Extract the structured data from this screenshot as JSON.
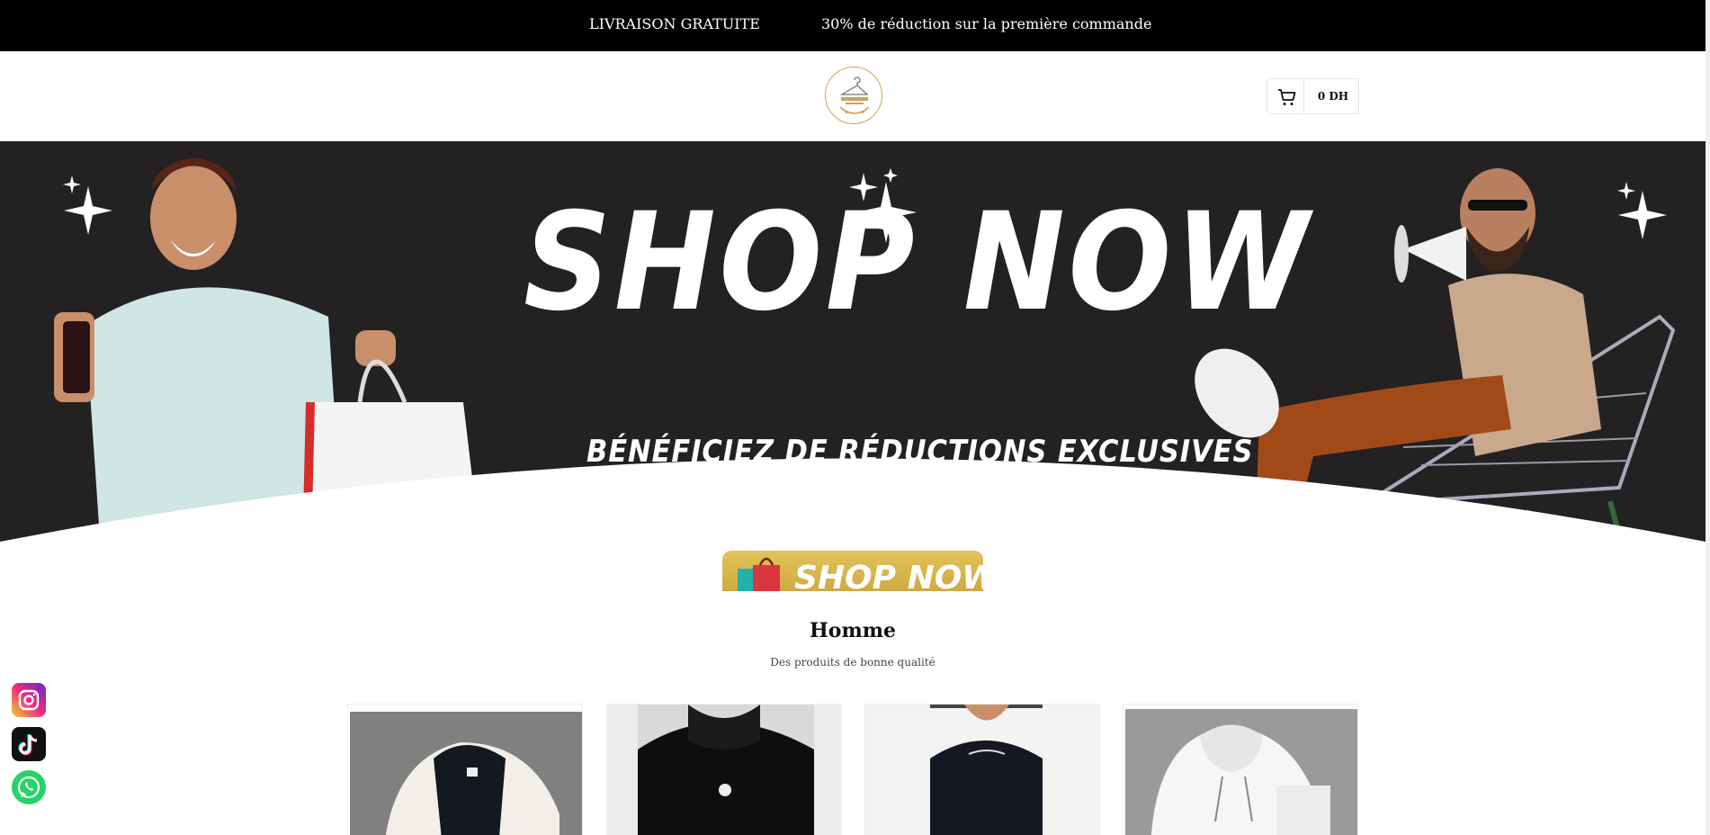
{
  "announcement_bar": {
    "items": [
      "LIVRAISON GRATUITE",
      "30% de réduction sur la première commande"
    ]
  },
  "header": {
    "logo_icon": "hanger-logo-icon",
    "cart": {
      "icon": "cart-icon",
      "total": "0 DH"
    }
  },
  "hero": {
    "title": "SHOP NOW",
    "subtitle": "BÉNÉFICIEZ DE RÉDUCTIONS EXCLUSIVES",
    "button_label": "SHOP NOW"
  },
  "section": {
    "title": "Homme",
    "subtitle": "Des produits de bonne qualité"
  },
  "social": [
    "instagram-icon",
    "tiktok-icon",
    "whatsapp-icon"
  ],
  "colors": {
    "topbar": "#000000",
    "hero_bg": "#232122",
    "gold": "#c9a23a",
    "whatsapp": "#25d366"
  }
}
